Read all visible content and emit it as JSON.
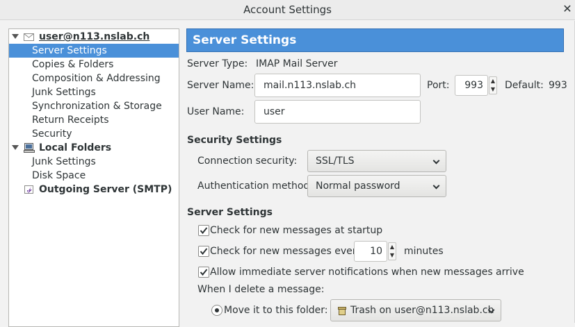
{
  "window": {
    "title": "Account Settings",
    "close_glyph": "✕"
  },
  "tree": {
    "account": "user@n113.nslab.ch",
    "account_items": [
      "Server Settings",
      "Copies & Folders",
      "Composition & Addressing",
      "Junk Settings",
      "Synchronization & Storage",
      "Return Receipts",
      "Security"
    ],
    "local": "Local Folders",
    "local_items": [
      "Junk Settings",
      "Disk Space"
    ],
    "smtp": "Outgoing Server (SMTP)",
    "selected": "Server Settings"
  },
  "panel": {
    "header": "Server Settings",
    "server_type_label": "Server Type:",
    "server_type_value": "IMAP Mail Server",
    "server_name_label": "Server Name:",
    "server_name_value": "mail.n113.nslab.ch",
    "port_label": "Port:",
    "port_value": "993",
    "default_label": "Default:",
    "default_value": "993",
    "user_name_label": "User Name:",
    "user_name_value": "user"
  },
  "security": {
    "heading": "Security Settings",
    "connection_label": "Connection security:",
    "connection_value": "SSL/TLS",
    "auth_label": "Authentication method:",
    "auth_value": "Normal password"
  },
  "server": {
    "heading": "Server Settings",
    "check_startup": "Check for new messages at startup",
    "check_every": "Check for new messages every",
    "every_value": "10",
    "minutes": "minutes",
    "allow_push": "Allow immediate server notifications when new messages arrive",
    "delete_label": "When I delete a message:",
    "move_label": "Move it to this folder:",
    "trash_folder": "Trash on user@n113.nslab.ch"
  },
  "colors": {
    "selection": "#4a90d9",
    "window_bg": "#f2f2f2"
  }
}
